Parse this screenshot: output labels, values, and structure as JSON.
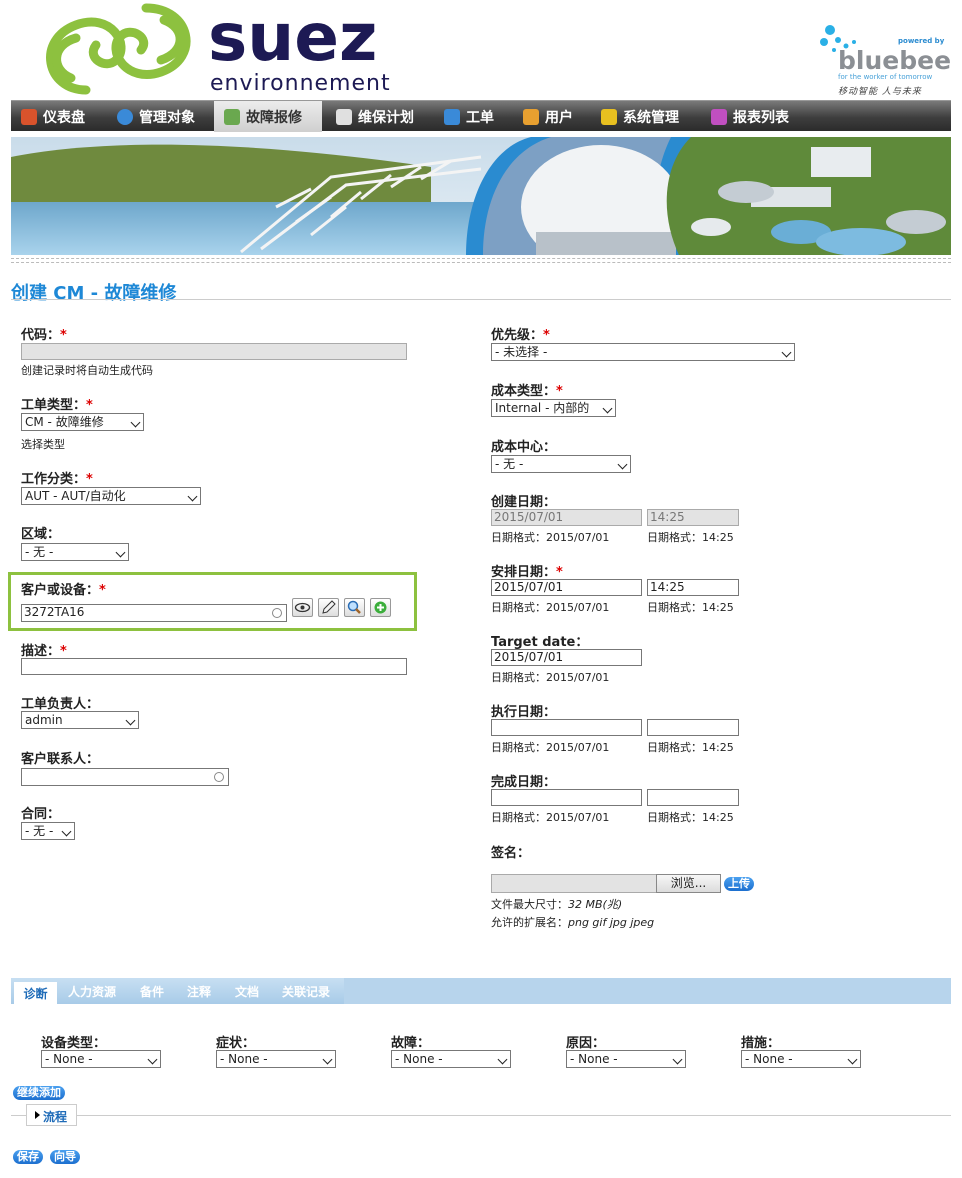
{
  "brand": {
    "logo_text": "suez",
    "logo_subtext": "environnement",
    "partner_powered": "powered by",
    "partner_name": "bluebee",
    "partner_tagline": "for the worker of tomorrow",
    "partner_cn": "移动智能 人与未来"
  },
  "nav": [
    {
      "label": "仪表盘",
      "icon": "house-icon",
      "color": "#d9532c"
    },
    {
      "label": "管理对象",
      "icon": "globe-icon",
      "color": "#3a8ad8"
    },
    {
      "label": "故障报修",
      "icon": "clipboard-icon",
      "color": "#6aa84f",
      "active": true
    },
    {
      "label": "维保计划",
      "icon": "envelope-icon",
      "color": "#e0e0e0"
    },
    {
      "label": "工单",
      "icon": "monitor-icon",
      "color": "#3a8ad8"
    },
    {
      "label": "用户",
      "icon": "users-icon",
      "color": "#e8a030"
    },
    {
      "label": "系统管理",
      "icon": "tools-icon",
      "color": "#e8c020"
    },
    {
      "label": "报表列表",
      "icon": "report-icon",
      "color": "#c04fc0"
    }
  ],
  "page_title": "创建 CM - 故障维修",
  "form": {
    "code": {
      "label": "代码：",
      "value": "",
      "hint": "创建记录时将自动生成代码"
    },
    "order_type": {
      "label": "工单类型：",
      "value": "CM - 故障维修",
      "hint": "选择类型"
    },
    "work_category": {
      "label": "工作分类：",
      "value": "AUT - AUT/自动化"
    },
    "area": {
      "label": "区域：",
      "value": "- 无 -"
    },
    "customer": {
      "label": "客户或设备：",
      "value": "3272TA16"
    },
    "description": {
      "label": "描述：",
      "value": ""
    },
    "owner": {
      "label": "工单负责人：",
      "value": "admin"
    },
    "contact": {
      "label": "客户联系人：",
      "value": ""
    },
    "contract": {
      "label": "合同：",
      "value": "- 无 -"
    },
    "priority": {
      "label": "优先级：",
      "value": "- 未选择 -"
    },
    "cost_type": {
      "label": "成本类型：",
      "value": "Internal - 内部的"
    },
    "cost_center": {
      "label": "成本中心：",
      "value": "- 无 -"
    },
    "created": {
      "label": "创建日期：",
      "date": "2015/07/01",
      "time": "14:25",
      "date_hint": "日期格式：2015/07/01",
      "time_hint": "日期格式：14:25"
    },
    "scheduled": {
      "label": "安排日期：",
      "date": "2015/07/01",
      "time": "14:25",
      "date_hint": "日期格式：2015/07/01",
      "time_hint": "日期格式：14:25"
    },
    "target": {
      "label": "Target date：",
      "date": "2015/07/01",
      "date_hint": "日期格式：2015/07/01"
    },
    "executed": {
      "label": "执行日期：",
      "date": "",
      "time": "",
      "date_hint": "日期格式：2015/07/01",
      "time_hint": "日期格式：14:25"
    },
    "completed": {
      "label": "完成日期：",
      "date": "",
      "time": "",
      "date_hint": "日期格式：2015/07/01",
      "time_hint": "日期格式：14:25"
    },
    "signature": {
      "label": "签名：",
      "browse": "浏览...",
      "upload": "上传",
      "max_size_label": "文件最大尺寸：",
      "max_size_value": "32 MB(兆)",
      "ext_label": "允许的扩展名：",
      "ext_value": "png gif jpg jpeg"
    },
    "required_mark": "*"
  },
  "tabs": [
    "诊断",
    "人力资源",
    "备件",
    "注释",
    "文档",
    "关联记录"
  ],
  "diagnosis": {
    "fields": [
      {
        "label": "设备类型：",
        "value": "- None -"
      },
      {
        "label": "症状：",
        "value": "- None -"
      },
      {
        "label": "故障：",
        "value": "- None -"
      },
      {
        "label": "原因：",
        "value": "- None -"
      },
      {
        "label": "措施：",
        "value": "- None -"
      }
    ],
    "add_more": "继续添加"
  },
  "workflow_label": "流程",
  "actions": {
    "save": "保存",
    "wizard": "向导"
  }
}
